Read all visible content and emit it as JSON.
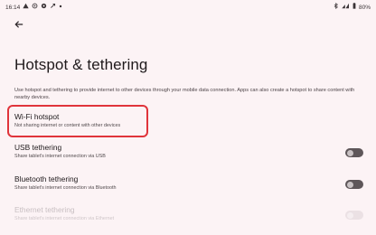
{
  "status_bar": {
    "time": "16:14",
    "left_icons": [
      "warning-icon",
      "hotspot-icon",
      "settings-icon",
      "link-icon",
      "dot-icon"
    ],
    "right_icons": [
      "bluetooth-icon",
      "wifi-signal-icon",
      "battery-icon"
    ],
    "battery": "80%"
  },
  "page": {
    "title": "Hotspot & tethering",
    "description": "Use hotspot and tethering to provide internet to other devices through your mobile data connection. Apps can also create a hotspot to share content with nearby devices."
  },
  "items": [
    {
      "title": "Wi-Fi hotspot",
      "subtitle": "Not sharing internet or content with other devices",
      "has_toggle": false,
      "highlighted": true
    },
    {
      "title": "USB tethering",
      "subtitle": "Share tablet's internet connection via USB",
      "has_toggle": true,
      "toggle_on": false,
      "enabled": true
    },
    {
      "title": "Bluetooth tethering",
      "subtitle": "Share tablet's internet connection via Bluetooth",
      "has_toggle": true,
      "toggle_on": false,
      "enabled": true
    },
    {
      "title": "Ethernet tethering",
      "subtitle": "Share tablet's internet connection via Ethernet",
      "has_toggle": true,
      "toggle_on": false,
      "enabled": false
    }
  ],
  "colors": {
    "background": "#fcf3f5",
    "highlight": "#e0343b",
    "toggle_off": "#5e5659"
  }
}
